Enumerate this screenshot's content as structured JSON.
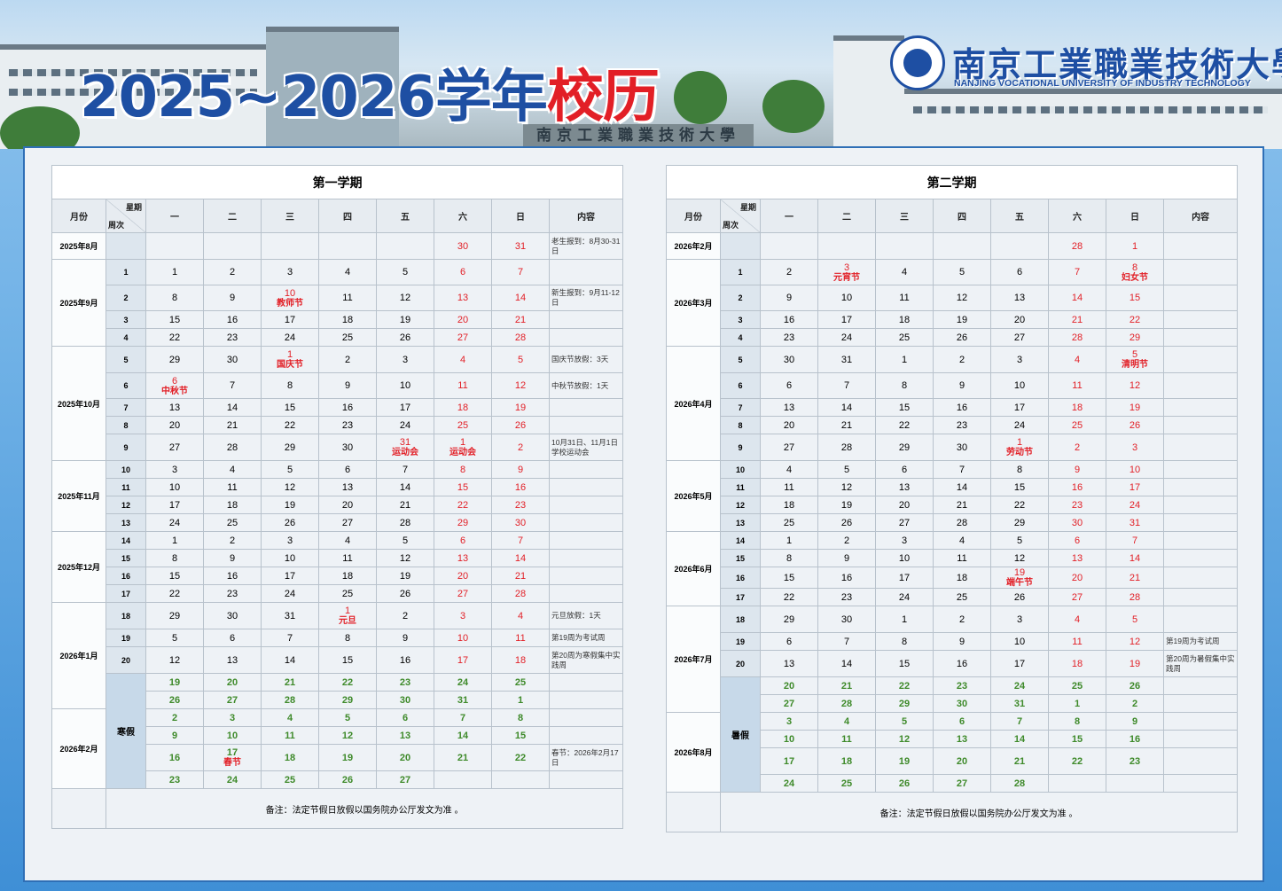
{
  "banner": {
    "title_year": "2025~2026学年",
    "title_main": "校历",
    "gate_text": "南京工業職業技術大學",
    "university_cn": "南京工業職業技術大學",
    "university_en": "NANJING VOCATIONAL UNIVERSITY OF INDUSTRY TECHNOLOGY"
  },
  "headers": {
    "month": "月份",
    "weekday": "星期",
    "week": "周次",
    "days": [
      "一",
      "二",
      "三",
      "四",
      "五",
      "六",
      "日"
    ],
    "content": "内容"
  },
  "colors": {
    "weekend": "#e21f26",
    "vacation": "#3e8a2a",
    "title_blue": "#1e4fa3"
  },
  "semester1": {
    "title": "第一学期",
    "footer": "备注：法定节假日放假以国务院办公厅发文为准 。",
    "rows": [
      {
        "month": "2025年8月",
        "span": 1,
        "week": "",
        "cells": [
          "",
          "",
          "",
          "",
          "",
          "30",
          "31"
        ],
        "note": "老生报到：8月30-31日"
      },
      {
        "month": "2025年9月",
        "span": 4,
        "week": "1",
        "cells": [
          "1",
          "2",
          "3",
          "4",
          "5",
          "6",
          "7"
        ],
        "note": ""
      },
      {
        "week": "2",
        "cells": [
          "8",
          "9",
          "10|教师节",
          "11",
          "12",
          "13",
          "14"
        ],
        "note": "新生报到：9月11-12日"
      },
      {
        "week": "3",
        "cells": [
          "15",
          "16",
          "17",
          "18",
          "19",
          "20",
          "21"
        ],
        "note": ""
      },
      {
        "week": "4",
        "cells": [
          "22",
          "23",
          "24",
          "25",
          "26",
          "27",
          "28"
        ],
        "note": ""
      },
      {
        "month": "2025年10月",
        "span": 5,
        "week": "5",
        "cells": [
          "29",
          "30",
          "1|国庆节",
          "2",
          "3",
          "4",
          "5"
        ],
        "note": "国庆节放假：3天"
      },
      {
        "week": "6",
        "cells": [
          "6|中秋节",
          "7",
          "8",
          "9",
          "10",
          "11",
          "12"
        ],
        "note": "中秋节放假：1天"
      },
      {
        "week": "7",
        "cells": [
          "13",
          "14",
          "15",
          "16",
          "17",
          "18",
          "19"
        ],
        "note": ""
      },
      {
        "week": "8",
        "cells": [
          "20",
          "21",
          "22",
          "23",
          "24",
          "25",
          "26"
        ],
        "note": ""
      },
      {
        "week": "9",
        "cells": [
          "27",
          "28",
          "29",
          "30",
          "31|运动会",
          "1|运动会",
          "2"
        ],
        "note": "10月31日、11月1日学校运动会"
      },
      {
        "month": "2025年11月",
        "span": 4,
        "week": "10",
        "cells": [
          "3",
          "4",
          "5",
          "6",
          "7",
          "8",
          "9"
        ],
        "note": ""
      },
      {
        "week": "11",
        "cells": [
          "10",
          "11",
          "12",
          "13",
          "14",
          "15",
          "16"
        ],
        "note": ""
      },
      {
        "week": "12",
        "cells": [
          "17",
          "18",
          "19",
          "20",
          "21",
          "22",
          "23"
        ],
        "note": ""
      },
      {
        "week": "13",
        "cells": [
          "24",
          "25",
          "26",
          "27",
          "28",
          "29",
          "30"
        ],
        "note": ""
      },
      {
        "month": "2025年12月",
        "span": 4,
        "week": "14",
        "cells": [
          "1",
          "2",
          "3",
          "4",
          "5",
          "6",
          "7"
        ],
        "note": ""
      },
      {
        "week": "15",
        "cells": [
          "8",
          "9",
          "10",
          "11",
          "12",
          "13",
          "14"
        ],
        "note": ""
      },
      {
        "week": "16",
        "cells": [
          "15",
          "16",
          "17",
          "18",
          "19",
          "20",
          "21"
        ],
        "note": ""
      },
      {
        "week": "17",
        "cells": [
          "22",
          "23",
          "24",
          "25",
          "26",
          "27",
          "28"
        ],
        "note": ""
      },
      {
        "month": "2026年1月",
        "span": 5,
        "week": "18",
        "cells": [
          "29",
          "30",
          "31",
          "1|元旦",
          "2",
          "3",
          "4"
        ],
        "note": "元旦放假：1天"
      },
      {
        "week": "19",
        "cells": [
          "5",
          "6",
          "7",
          "8",
          "9",
          "10",
          "11"
        ],
        "note": "第19周为考试周"
      },
      {
        "week": "20",
        "cells": [
          "12",
          "13",
          "14",
          "15",
          "16",
          "17",
          "18"
        ],
        "note": "第20周为寒假集中实践周"
      },
      {
        "vac": "寒假",
        "vspan": 6,
        "g": true,
        "cells": [
          "19",
          "20",
          "21",
          "22",
          "23",
          "24",
          "25"
        ],
        "note": ""
      },
      {
        "g": true,
        "cells": [
          "26",
          "27",
          "28",
          "29",
          "30",
          "31",
          "1"
        ],
        "note": ""
      },
      {
        "month": "2026年2月",
        "span": 4,
        "g": true,
        "cells": [
          "2",
          "3",
          "4",
          "5",
          "6",
          "7",
          "8"
        ],
        "note": ""
      },
      {
        "g": true,
        "cells": [
          "9",
          "10",
          "11",
          "12",
          "13",
          "14",
          "15"
        ],
        "note": ""
      },
      {
        "g": true,
        "cells": [
          "16",
          "17|春节",
          "18",
          "19",
          "20",
          "21",
          "22"
        ],
        "note": "春节：2026年2月17日"
      },
      {
        "g": true,
        "cells": [
          "23",
          "24",
          "25",
          "26",
          "27",
          "",
          ""
        ],
        "note": ""
      }
    ]
  },
  "semester2": {
    "title": "第二学期",
    "footer": "备注：法定节假日放假以国务院办公厅发文为准 。",
    "rows": [
      {
        "month": "2026年2月",
        "span": 1,
        "week": "",
        "cells": [
          "",
          "",
          "",
          "",
          "",
          "28",
          "1"
        ],
        "note": ""
      },
      {
        "month": "2026年3月",
        "span": 4,
        "week": "1",
        "cells": [
          "2",
          "3|元宵节",
          "4",
          "5",
          "6",
          "7",
          "8|妇女节"
        ],
        "note": ""
      },
      {
        "week": "2",
        "cells": [
          "9",
          "10",
          "11",
          "12",
          "13",
          "14",
          "15"
        ],
        "note": ""
      },
      {
        "week": "3",
        "cells": [
          "16",
          "17",
          "18",
          "19",
          "20",
          "21",
          "22"
        ],
        "note": ""
      },
      {
        "week": "4",
        "cells": [
          "23",
          "24",
          "25",
          "26",
          "27",
          "28",
          "29"
        ],
        "note": ""
      },
      {
        "month": "2026年4月",
        "span": 5,
        "week": "5",
        "cells": [
          "30",
          "31",
          "1",
          "2",
          "3",
          "4",
          "5|清明节"
        ],
        "note": ""
      },
      {
        "week": "6",
        "cells": [
          "6",
          "7",
          "8",
          "9",
          "10",
          "11",
          "12"
        ],
        "note": ""
      },
      {
        "week": "7",
        "cells": [
          "13",
          "14",
          "15",
          "16",
          "17",
          "18",
          "19"
        ],
        "note": ""
      },
      {
        "week": "8",
        "cells": [
          "20",
          "21",
          "22",
          "23",
          "24",
          "25",
          "26"
        ],
        "note": ""
      },
      {
        "week": "9",
        "cells": [
          "27",
          "28",
          "29",
          "30",
          "1|劳动节",
          "2",
          "3"
        ],
        "note": ""
      },
      {
        "month": "2026年5月",
        "span": 4,
        "week": "10",
        "cells": [
          "4",
          "5",
          "6",
          "7",
          "8",
          "9",
          "10"
        ],
        "note": ""
      },
      {
        "week": "11",
        "cells": [
          "11",
          "12",
          "13",
          "14",
          "15",
          "16",
          "17"
        ],
        "note": ""
      },
      {
        "week": "12",
        "cells": [
          "18",
          "19",
          "20",
          "21",
          "22",
          "23",
          "24"
        ],
        "note": ""
      },
      {
        "week": "13",
        "cells": [
          "25",
          "26",
          "27",
          "28",
          "29",
          "30",
          "31"
        ],
        "note": ""
      },
      {
        "month": "2026年6月",
        "span": 4,
        "week": "14",
        "cells": [
          "1",
          "2",
          "3",
          "4",
          "5",
          "6",
          "7"
        ],
        "note": ""
      },
      {
        "week": "15",
        "cells": [
          "8",
          "9",
          "10",
          "11",
          "12",
          "13",
          "14"
        ],
        "note": ""
      },
      {
        "week": "16",
        "cells": [
          "15",
          "16",
          "17",
          "18",
          "19|端午节",
          "20",
          "21"
        ],
        "note": ""
      },
      {
        "week": "17",
        "cells": [
          "22",
          "23",
          "24",
          "25",
          "26",
          "27",
          "28"
        ],
        "note": ""
      },
      {
        "month": "2026年7月",
        "span": 5,
        "week": "18",
        "cells": [
          "29",
          "30",
          "1",
          "2",
          "3",
          "4",
          "5"
        ],
        "note": ""
      },
      {
        "week": "19",
        "cells": [
          "6",
          "7",
          "8",
          "9",
          "10",
          "11",
          "12"
        ],
        "note": "第19周为考试周"
      },
      {
        "week": "20",
        "cells": [
          "13",
          "14",
          "15",
          "16",
          "17",
          "18",
          "19"
        ],
        "note": "第20周为暑假集中实践周"
      },
      {
        "vac": "暑假",
        "vspan": 6,
        "g": true,
        "cells": [
          "20",
          "21",
          "22",
          "23",
          "24",
          "25",
          "26"
        ],
        "note": ""
      },
      {
        "g": true,
        "cells": [
          "27",
          "28",
          "29",
          "30",
          "31",
          "1",
          "2"
        ],
        "note": ""
      },
      {
        "month": "2026年8月",
        "span": 4,
        "g": true,
        "cells": [
          "3",
          "4",
          "5",
          "6",
          "7",
          "8",
          "9"
        ],
        "note": ""
      },
      {
        "g": true,
        "cells": [
          "10",
          "11",
          "12",
          "13",
          "14",
          "15",
          "16"
        ],
        "note": ""
      },
      {
        "g": true,
        "cells": [
          "17",
          "18",
          "19",
          "20",
          "21",
          "22",
          "23"
        ],
        "note": ""
      },
      {
        "g": true,
        "cells": [
          "24",
          "25",
          "26",
          "27",
          "28",
          "",
          ""
        ],
        "note": ""
      }
    ]
  }
}
